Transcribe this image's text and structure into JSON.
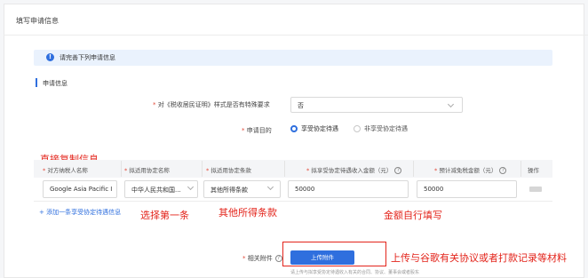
{
  "card_title": "填写申请信息",
  "notice": {
    "text": "请完善下列申请信息",
    "icon": "info-icon"
  },
  "section_title": "申请信息",
  "special_requirement": {
    "label": "对《税收居民证明》样式是否有特殊要求",
    "value": "否"
  },
  "purpose": {
    "label": "申请目的",
    "options": [
      {
        "label": "享受协定待遇",
        "selected": true
      },
      {
        "label": "非享受协定待遇",
        "selected": false
      }
    ]
  },
  "table": {
    "headers": [
      "对方纳税人名称",
      "拟适用协定名称",
      "拟适用协定条款",
      "拟享受协定待遇收入金额（元）",
      "预计减免税金额（元）",
      "操作"
    ],
    "row": {
      "counterparty": "Google Asia Pacific I",
      "agreement": "中华人民共和国...",
      "clause": "其他所得条款",
      "income_amount": "50000",
      "relief_amount": "50000"
    },
    "add_link": "+ 添加一条享受协定待遇信息"
  },
  "attachment": {
    "label": "相关附件",
    "button": "上传附件",
    "hint": "请上传与拟享受协定待遇收入有关的合同、协议、董事会或者股东"
  },
  "annotations": {
    "copy_directly": "直接复制信息",
    "choose_first": "选择第一条",
    "other_income_clause": "其他所得条款",
    "fill_amount": "金额自行填写",
    "upload_note": "上传与谷歌有关协议或者打款记录等材料"
  },
  "colors": {
    "accent": "#2f6fde",
    "annotation": "#e3241b",
    "required": "#e24a3a"
  }
}
